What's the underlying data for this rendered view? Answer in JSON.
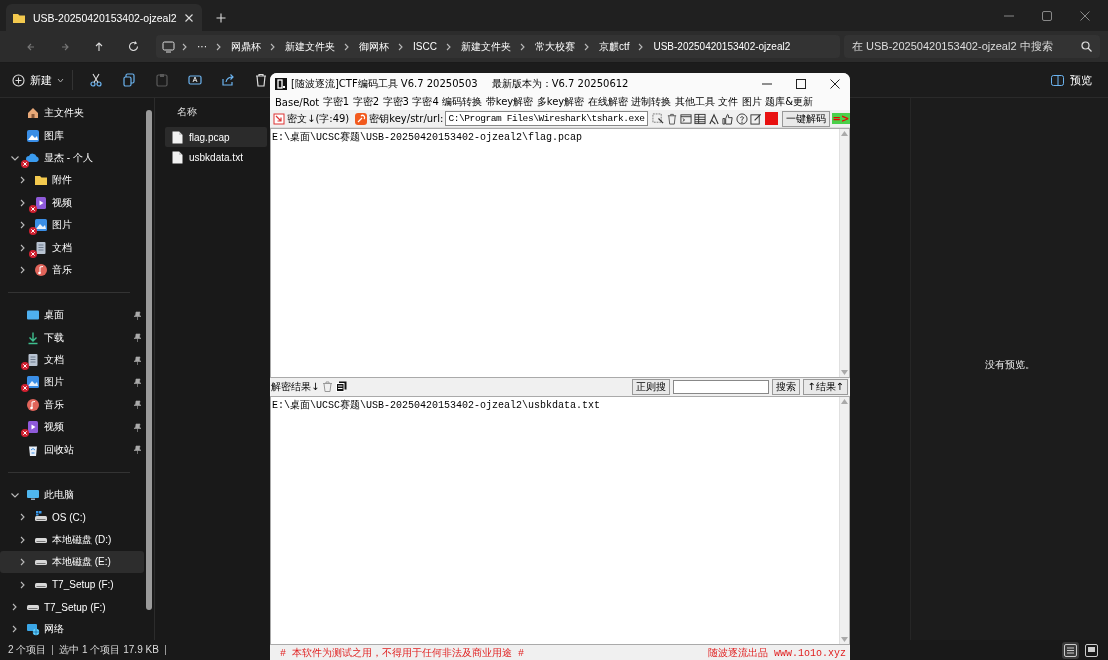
{
  "tabs": [
    {
      "title": "USB-20250420153402-ojzeal2",
      "selected": true
    }
  ],
  "address_bar": {
    "overflow": "···",
    "breadcrumbs": [
      "网鼎杯",
      "新建文件夹",
      "御网杯",
      "ISCC",
      "新建文件夹",
      "常大校赛",
      "京麒ctf",
      "USB-20250420153402-ojzeal2"
    ],
    "search": {
      "placeholder": "在 USB-20250420153402-ojzeal2 中搜索"
    }
  },
  "command_bar": {
    "new_button": "新建",
    "actions": [
      {
        "kind": "cut",
        "disabled": false
      },
      {
        "kind": "copy",
        "disabled": false
      },
      {
        "kind": "paste",
        "disabled": true
      },
      {
        "kind": "rename",
        "disabled": false
      },
      {
        "kind": "share",
        "disabled": false
      },
      {
        "kind": "delete",
        "disabled": false
      }
    ],
    "preview_button": "预览"
  },
  "navigation": {
    "groups": [
      [
        {
          "label": "主文件夹",
          "kind": "home",
          "selected": false,
          "sync_error": false
        },
        {
          "label": "图库",
          "kind": "gallery",
          "selected": false,
          "sync_error": false
        },
        {
          "label": "显杰 - 个人",
          "kind": "cloud",
          "selected": false,
          "sync_error": true,
          "expanded": true,
          "children": [
            {
              "label": "附件",
              "kind": "folder",
              "selected": false,
              "sync_error": false,
              "expanded": false
            },
            {
              "label": "视频",
              "kind": "video",
              "selected": false,
              "sync_error": true,
              "expanded": false
            },
            {
              "label": "图片",
              "kind": "picture",
              "selected": false,
              "sync_error": true,
              "expanded": false
            },
            {
              "label": "文档",
              "kind": "document",
              "selected": false,
              "sync_error": true,
              "expanded": false
            },
            {
              "label": "音乐",
              "kind": "music",
              "selected": false,
              "sync_error": false,
              "expanded": false
            }
          ]
        }
      ],
      [
        {
          "label": "桌面",
          "kind": "desktop",
          "selected": false,
          "sync_error": false,
          "pinned": true
        },
        {
          "label": "下载",
          "kind": "download",
          "selected": false,
          "sync_error": false,
          "pinned": true
        },
        {
          "label": "文档",
          "kind": "document",
          "selected": false,
          "sync_error": true,
          "pinned": true
        },
        {
          "label": "图片",
          "kind": "picture",
          "selected": false,
          "sync_error": true,
          "pinned": true
        },
        {
          "label": "音乐",
          "kind": "music",
          "selected": false,
          "sync_error": false,
          "pinned": true
        },
        {
          "label": "视频",
          "kind": "video",
          "selected": false,
          "sync_error": true,
          "pinned": true
        },
        {
          "label": "回收站",
          "kind": "recycle",
          "selected": false,
          "sync_error": false,
          "pinned": true
        }
      ],
      [
        {
          "label": "此电脑",
          "kind": "pc",
          "selected": false,
          "sync_error": false,
          "expanded": true,
          "children": [
            {
              "label": "OS (C:)",
              "kind": "os_drive",
              "selected": false,
              "sync_error": false,
              "expanded": false
            },
            {
              "label": "本地磁盘 (D:)",
              "kind": "drive",
              "selected": false,
              "sync_error": false,
              "expanded": false
            },
            {
              "label": "本地磁盘 (E:)",
              "kind": "drive",
              "selected": true,
              "sync_error": false,
              "expanded": false
            },
            {
              "label": "T7_Setup (F:)",
              "kind": "drive",
              "selected": false,
              "sync_error": false,
              "expanded": false
            }
          ]
        },
        {
          "label": "T7_Setup (F:)",
          "kind": "drive",
          "selected": false,
          "sync_error": false,
          "expanded": false
        },
        {
          "label": "网络",
          "kind": "network",
          "selected": false,
          "sync_error": false,
          "expanded": false
        }
      ]
    ]
  },
  "file_list": {
    "columns": [
      "名称"
    ],
    "files": [
      {
        "name": "flag.pcap",
        "selected": true
      },
      {
        "name": "usbkdata.txt",
        "selected": false
      }
    ]
  },
  "preview": {
    "message": "没有预览。"
  },
  "status_bar": {
    "items": [
      "2 个项目",
      "选中 1 个项目 17.9 KB"
    ],
    "view_modes": [
      {
        "kind": "details",
        "selected": true
      },
      {
        "kind": "tiles",
        "selected": false
      }
    ]
  },
  "ctf_window": {
    "title": "[随波逐流]CTF编码工具 V6.7 20250503",
    "latest_version": "最新版本为：V6.7  20250612",
    "menu": [
      "Base/Rot",
      "字密1",
      "字密2",
      "字密3",
      "字密4",
      "编码转换",
      "带key解密",
      "多key解密",
      "在线解密",
      "进制转换",
      "其他工具",
      "文件",
      "图片",
      "题库&更新"
    ],
    "cipher_label": "密文↓(字:49)",
    "key_label": "密钥key/str/url:",
    "key_value": "C:\\Program Files\\Wireshark\\tshark.exe",
    "decode_button": "一键解码",
    "arrow": "=>",
    "input_text": "E:\\桌面\\UCSC赛题\\USB-20250420153402-ojzeal2\\flag.pcap",
    "result_label": "解密结果↓",
    "regex_button": "正则搜",
    "search_button": "搜索",
    "result_nav_button": "↑结果↑",
    "output_text": "E:\\桌面\\UCSC赛题\\USB-20250420153402-ojzeal2\\usbkdata.txt",
    "footer_notice": "# 本软件为测试之用，不得用于任何非法及商业用途 #",
    "footer_credit": "随波逐流出品 www.1o1o.xyz"
  }
}
